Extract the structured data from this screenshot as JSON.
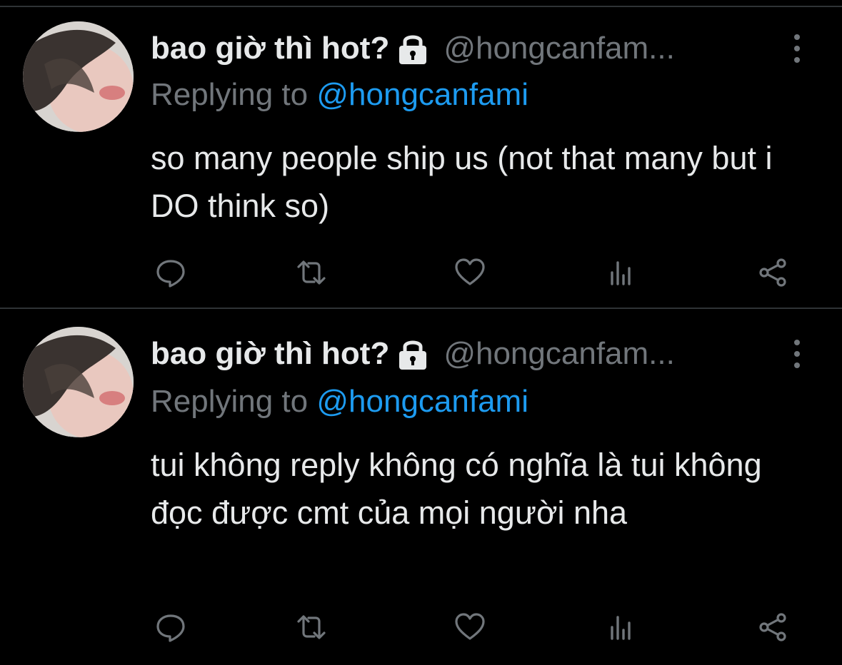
{
  "tweets": [
    {
      "name": "bao giờ thì hot?",
      "handle": "@hongcanfam...",
      "replying_prefix": "Replying to ",
      "replying_to": "@hongcanfami",
      "text": "so many people ship us (not that many but i DO think so)"
    },
    {
      "name": "bao giờ thì hot?",
      "handle": "@hongcanfam...",
      "replying_prefix": "Replying to ",
      "replying_to": "@hongcanfami",
      "text": "tui không reply không có nghĩa là tui không đọc được cmt của mọi người nha"
    }
  ],
  "icons": {
    "lock": "lock-icon",
    "more": "more-vertical-icon",
    "reply": "reply-icon",
    "retweet": "retweet-icon",
    "like": "heart-icon",
    "views": "analytics-icon",
    "share": "share-icon"
  },
  "colors": {
    "background": "#000000",
    "text": "#e7e9ea",
    "muted": "#71767b",
    "link": "#1d9bf0",
    "divider": "#2f3336"
  }
}
